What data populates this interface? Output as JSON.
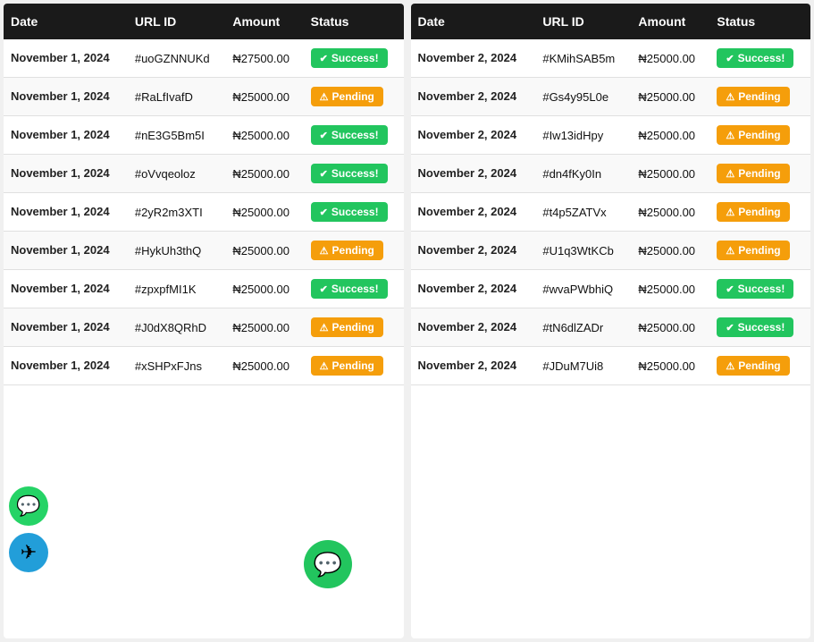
{
  "left_table": {
    "headers": [
      "Date",
      "URL ID",
      "Amount",
      "Status"
    ],
    "rows": [
      {
        "date": "November 1, 2024",
        "url_id": "#uoGZNNUKd",
        "amount": "₦27500.00",
        "status": "Success!"
      },
      {
        "date": "November 1, 2024",
        "url_id": "#RaLfIvafD",
        "amount": "₦25000.00",
        "status": "Pending"
      },
      {
        "date": "November 1, 2024",
        "url_id": "#nE3G5Bm5I",
        "amount": "₦25000.00",
        "status": "Success!"
      },
      {
        "date": "November 1, 2024",
        "url_id": "#oVvqeoloz",
        "amount": "₦25000.00",
        "status": "Success!"
      },
      {
        "date": "November 1, 2024",
        "url_id": "#2yR2m3XTI",
        "amount": "₦25000.00",
        "status": "Success!"
      },
      {
        "date": "November 1, 2024",
        "url_id": "#HykUh3thQ",
        "amount": "₦25000.00",
        "status": "Pending"
      },
      {
        "date": "November 1, 2024",
        "url_id": "#zpxpfMI1K",
        "amount": "₦25000.00",
        "status": "Success!"
      },
      {
        "date": "November 1, 2024",
        "url_id": "#J0dX8QRhD",
        "amount": "₦25000.00",
        "status": "Pending"
      },
      {
        "date": "November 1, 2024",
        "url_id": "#xSHPxFJns",
        "amount": "₦25000.00",
        "status": "Pending"
      }
    ]
  },
  "right_table": {
    "headers": [
      "Date",
      "URL ID",
      "Amount",
      "Status"
    ],
    "rows": [
      {
        "date": "November 2, 2024",
        "url_id": "#KMihSAB5m",
        "amount": "₦25000.00",
        "status": "Success!"
      },
      {
        "date": "November 2, 2024",
        "url_id": "#Gs4y95L0e",
        "amount": "₦25000.00",
        "status": "Pending"
      },
      {
        "date": "November 2, 2024",
        "url_id": "#Iw13idHpy",
        "amount": "₦25000.00",
        "status": "Pending"
      },
      {
        "date": "November 2, 2024",
        "url_id": "#dn4fKy0In",
        "amount": "₦25000.00",
        "status": "Pending"
      },
      {
        "date": "November 2, 2024",
        "url_id": "#t4p5ZATVx",
        "amount": "₦25000.00",
        "status": "Pending"
      },
      {
        "date": "November 2, 2024",
        "url_id": "#U1q3WtKCb",
        "amount": "₦25000.00",
        "status": "Pending"
      },
      {
        "date": "November 2, 2024",
        "url_id": "#wvaPWbhiQ",
        "amount": "₦25000.00",
        "status": "Success!"
      },
      {
        "date": "November 2, 2024",
        "url_id": "#tN6dlZADr",
        "amount": "₦25000.00",
        "status": "Success!"
      },
      {
        "date": "November 2, 2024",
        "url_id": "#JDuM7Ui8",
        "amount": "₦25000.00",
        "status": "Pending"
      }
    ]
  },
  "floating": {
    "whatsapp_label": "WhatsApp",
    "telegram_label": "Telegram",
    "chat_label": "Chat"
  }
}
